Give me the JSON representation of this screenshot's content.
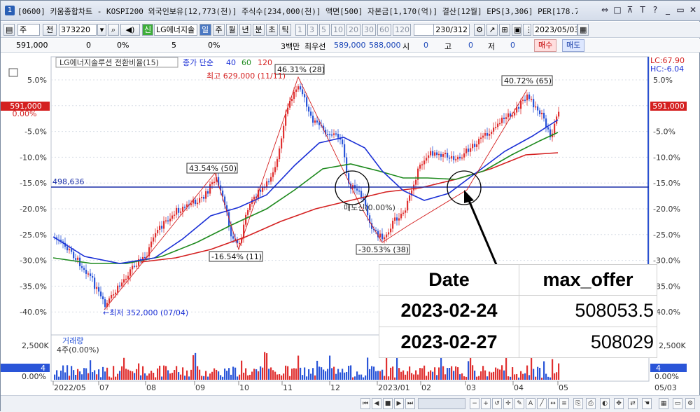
{
  "window": {
    "app_number": "1",
    "title": "[0600] 키움종합차트 - KOSPI200 외국인보유[12,773(천)] 주식수[234,000(천)] 액면[500] 자본금[1,170(억)] 결산[12월] EPS[3,306] PER[178.7"
  },
  "toolbar": {
    "period_select": "주",
    "prev_label": "전",
    "code_value": "373220",
    "sin_label": "신",
    "stock_name": "LG에너지솔",
    "periods": [
      "일",
      "주",
      "월",
      "년",
      "분",
      "초",
      "틱"
    ],
    "active_period": "일",
    "intervals": [
      "1",
      "3",
      "5",
      "10",
      "20",
      "30",
      "60",
      "120"
    ],
    "page_counter": "230/312",
    "date_value": "2023/05/03"
  },
  "price_bar": {
    "price": "591,000",
    "change": "0",
    "change_pct": "0%",
    "volume": "5",
    "volume_pct": "0%",
    "unit": "3백만",
    "best_label": "최우선",
    "best_ask": "589,000",
    "best_bid": "588,000",
    "open_label": "시",
    "open_value": "0",
    "high_label": "고",
    "high_value": "0",
    "low_label": "저",
    "low_value": "0",
    "buy_button": "매수",
    "sell_button": "매도"
  },
  "chart": {
    "legend_title": "LG에너지솔루션 전환비율(15)",
    "ma_label": "종가 단순",
    "ma_periods": [
      "40",
      "60",
      "120"
    ],
    "lc_label": "LC:67.90",
    "hc_label": "HC:-6.04",
    "peak_label": "최고 629,000 (11/11)",
    "low_label": "←최저 352,000 (07/04)",
    "hline_value": "498,636",
    "price_marker": "591,000",
    "price_marker_pct": "0.00%",
    "sell_signal": "매도신(0.00%)",
    "annotations": [
      "46.31% (28)",
      "43.54% (50)",
      "-16.54% (11)",
      "-30.53% (38)",
      "40.72% (65)"
    ],
    "y_ticks": [
      "5.0%",
      "0.00%",
      "-5.0%",
      "-10.0%",
      "-15.0%",
      "-20.0%",
      "-25.0%",
      "-30.0%",
      "-35.0%",
      "-40.0%"
    ],
    "right_y_ticks": [
      "5.0%",
      "0.00%",
      "-5.0%",
      "-10.0%",
      "-15.0%",
      "-20.0%",
      "-25.0%",
      "-30.0%",
      "-35.0%",
      "-40.0%"
    ],
    "x_ticks": [
      "2022/05",
      "07",
      "08",
      "09",
      "10",
      "11",
      "12",
      "2023/01",
      "02",
      "03",
      "04",
      "05"
    ],
    "x_end_label": "05/03",
    "volume_title": "거래량",
    "volume_sub": "4주(0.00%)",
    "volume_ticks": [
      "2,500K",
      "0.00%"
    ],
    "volume_marker": "4",
    "colors": {
      "ma40": "#1a2fd6",
      "ma60": "#1e8a1e",
      "ma120": "#d42020",
      "up": "#e03030",
      "down": "#2a55d8",
      "hline": "#1a2fa8"
    }
  },
  "table": {
    "headers": [
      "Date",
      "max_offer"
    ],
    "rows": [
      [
        "2023-02-24",
        "508053.5"
      ],
      [
        "2023-02-27",
        "508029"
      ]
    ]
  }
}
